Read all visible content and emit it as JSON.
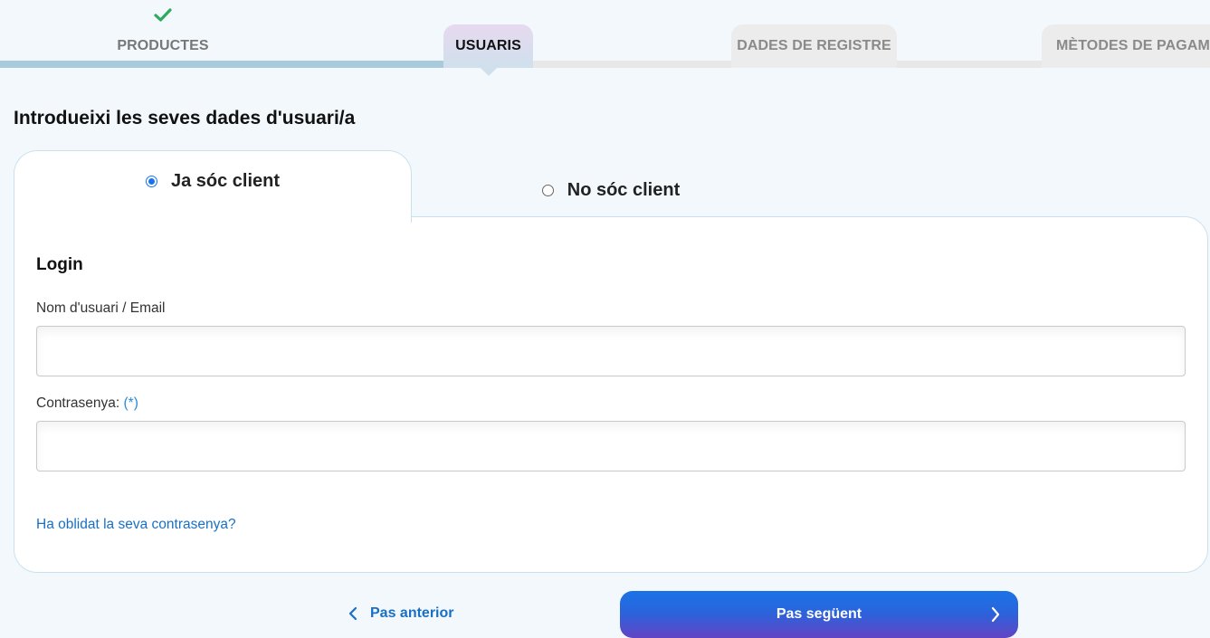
{
  "stepper": {
    "steps": [
      {
        "label": "PRODUCTES",
        "state": "done"
      },
      {
        "label": "USUARIS",
        "state": "active"
      },
      {
        "label": "DADES DE REGISTRE",
        "state": "pending"
      },
      {
        "label": "MÈTODES DE PAGAMENT",
        "state": "pending"
      }
    ],
    "done_icon": "check-icon",
    "colors": {
      "done_check": "#2eaa5c",
      "progress": "#a9cadb",
      "active_tab": "#e7d9ef"
    }
  },
  "page": {
    "title": "Introdueixi les seves dades d'usuari/a"
  },
  "tabs": [
    {
      "label": "Ja sóc client",
      "selected": true
    },
    {
      "label": "No sóc client",
      "selected": false
    }
  ],
  "login": {
    "title": "Login",
    "username_label": "Nom d'usuari / Email",
    "username_value": "",
    "password_label": "Contrasenya:",
    "password_required": "(*)",
    "password_value": "",
    "forgot_link": "Ha oblidat la seva contrasenya?"
  },
  "nav": {
    "prev_label": "Pas anterior",
    "next_label": "Pas següent",
    "accent": "#1b73e6"
  }
}
